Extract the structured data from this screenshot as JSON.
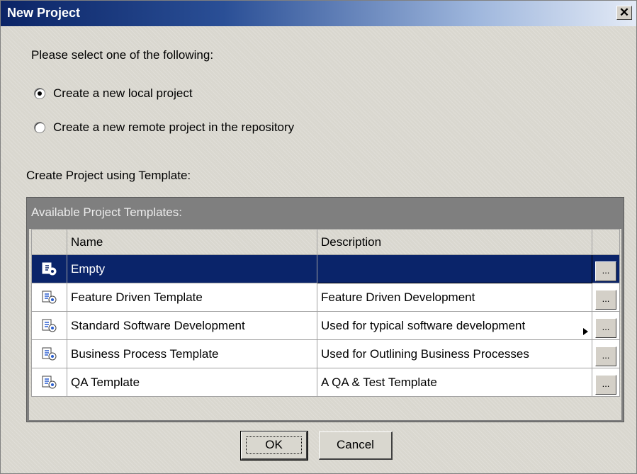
{
  "window": {
    "title": "New Project",
    "close_glyph": "✕"
  },
  "prompt": "Please select one of the following:",
  "options": [
    {
      "label": "Create a new local project",
      "selected": true
    },
    {
      "label": "Create a new remote project in the repository",
      "selected": false
    }
  ],
  "template_section_label": "Create Project using Template:",
  "templates_panel": {
    "caption": "Available Project Templates:",
    "columns": [
      "",
      "Name",
      "Description",
      ""
    ],
    "rows": [
      {
        "icon": "project-template-icon",
        "name": "Empty",
        "description": "",
        "selected": true,
        "button": "..."
      },
      {
        "icon": "project-template-icon",
        "name": "Feature Driven Template",
        "description": "Feature Driven Development",
        "selected": false,
        "button": "..."
      },
      {
        "icon": "project-template-icon",
        "name": "Standard Software Development",
        "description": "Used for typical software development",
        "selected": false,
        "button": "..."
      },
      {
        "icon": "project-template-icon",
        "name": "Business Process Template",
        "description": "Used for Outlining Business Processes",
        "selected": false,
        "button": "..."
      },
      {
        "icon": "project-template-icon",
        "name": "QA Template",
        "description": "A QA & Test Template",
        "selected": false,
        "button": "..."
      }
    ]
  },
  "buttons": {
    "ok": "OK",
    "cancel": "Cancel"
  },
  "colors": {
    "title_start": "#0b2466",
    "selection": "#0a246a",
    "panel_header": "#7f7f7f"
  }
}
